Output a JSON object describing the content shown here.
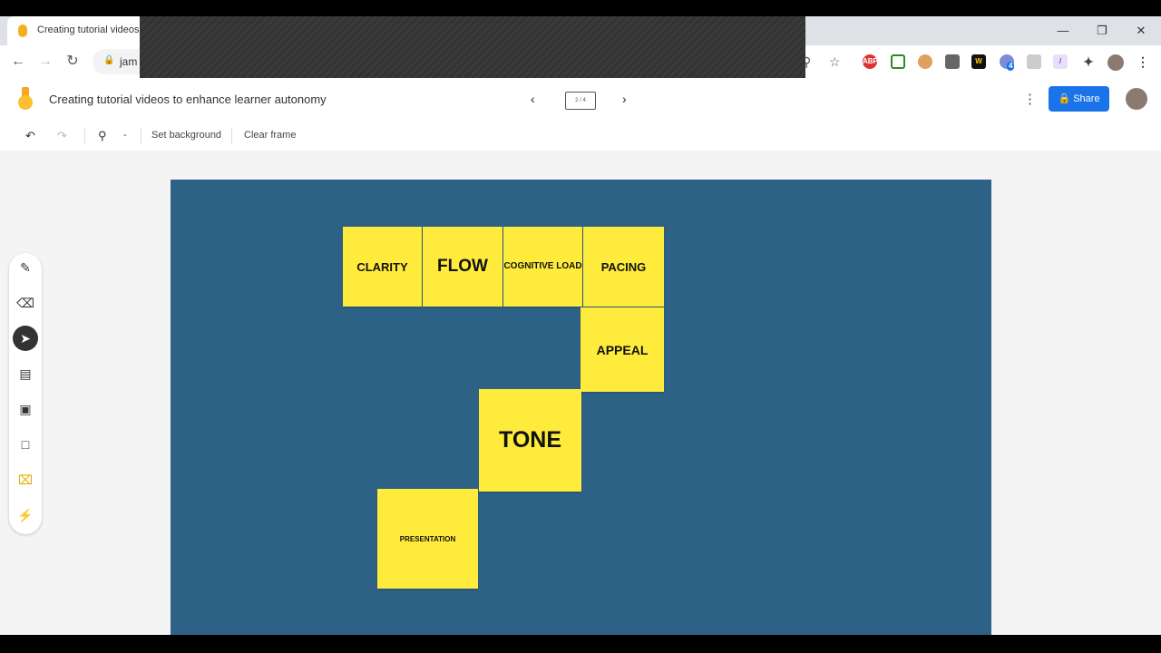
{
  "browser": {
    "tab_title": "Creating tutorial videos",
    "url_partial": "jam",
    "window_controls": {
      "minimize": "—",
      "maximize": "❐",
      "close": "✕"
    },
    "extension_badge": "4"
  },
  "app": {
    "title": "Creating tutorial videos to enhance learner autonomy",
    "frame_indicator": "2 / 4",
    "share_label": "Share"
  },
  "edit_toolbar": {
    "zoom_label": "-",
    "set_background_label": "Set background",
    "clear_frame_label": "Clear frame"
  },
  "canvas": {
    "background_color": "#2d6286",
    "notes": [
      {
        "text": "CLARITY"
      },
      {
        "text": "FLOW"
      },
      {
        "text": "COGNITIVE LOAD"
      },
      {
        "text": "PACING"
      },
      {
        "text": "APPEAL"
      },
      {
        "text": "TONE"
      },
      {
        "text": "PRESENTATION"
      }
    ]
  }
}
